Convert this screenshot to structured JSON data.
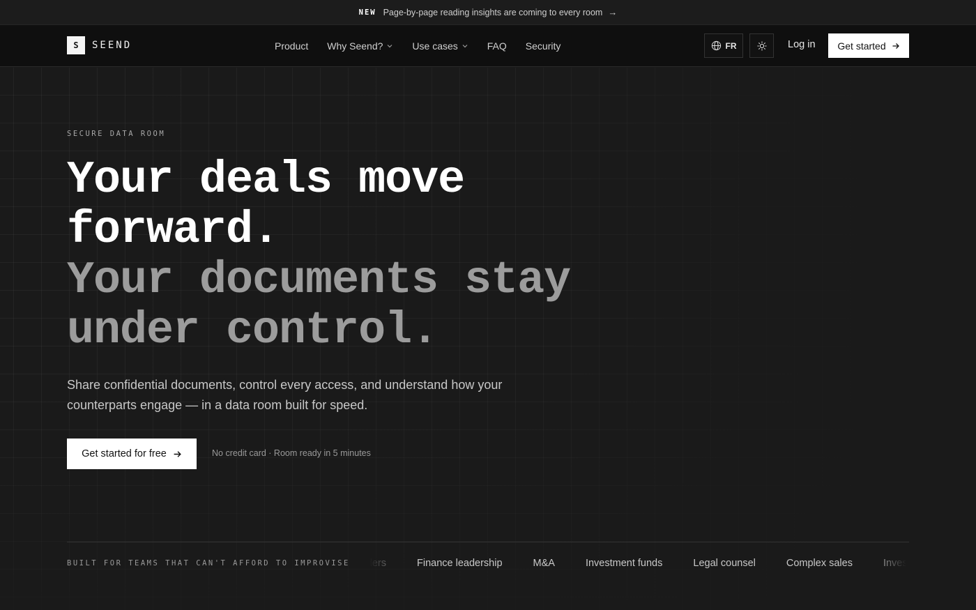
{
  "announcement": {
    "tag": "NEW",
    "text": "Page-by-page reading insights are coming to every room",
    "arrow": "→"
  },
  "nav": {
    "logo_mark": "S",
    "logo_text": "SEEND",
    "items": [
      {
        "label": "Product",
        "dropdown": false
      },
      {
        "label": "Why Seend?",
        "dropdown": true
      },
      {
        "label": "Use cases",
        "dropdown": true
      },
      {
        "label": "FAQ",
        "dropdown": false
      },
      {
        "label": "Security",
        "dropdown": false
      }
    ],
    "language": "FR",
    "login": "Log in",
    "cta": "Get started",
    "icons": {
      "language": "globe-icon",
      "theme": "sun-icon",
      "arrow": "arrow-right-icon",
      "chevron": "chevron-down-icon"
    }
  },
  "hero": {
    "eyebrow": "SECURE DATA ROOM",
    "headline_line1": "Your deals move forward.",
    "headline_line2": "Your documents stay under control.",
    "subtitle": "Share confidential documents, control every access, and understand how your counterparts engage — in a data room built for speed.",
    "cta": "Get started for free",
    "note": "No credit card · Room ready in 5 minutes"
  },
  "audiences": {
    "label": "BUILT FOR TEAMS THAT CAN'T AFFORD TO IMPROVISE",
    "items": [
      "Founders",
      "Finance leadership",
      "M&A",
      "Investment funds",
      "Legal counsel",
      "Complex sales",
      "Investors"
    ]
  },
  "colors": {
    "background": "#1a1a1a",
    "nav_background": "#0f0f0f",
    "headline_primary": "#ffffff",
    "headline_secondary": "#9c9c9c",
    "button": "#ffffff"
  }
}
